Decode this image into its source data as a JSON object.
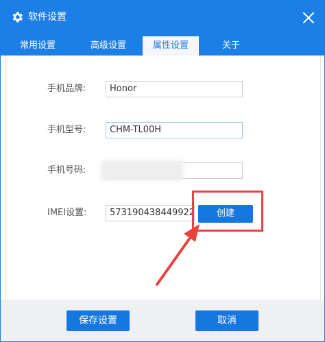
{
  "window": {
    "title": "软件设置"
  },
  "tabs": [
    {
      "label": "常用设置",
      "active": false
    },
    {
      "label": "高级设置",
      "active": false
    },
    {
      "label": "属性设置",
      "active": true
    },
    {
      "label": "关于",
      "active": false
    }
  ],
  "form": {
    "brand": {
      "label": "手机品牌:",
      "value": "Honor"
    },
    "model": {
      "label": "手机型号:",
      "value": "CHM-TL00H"
    },
    "number": {
      "label": "手机号码:",
      "value": ""
    },
    "imei": {
      "label": "IMEI设置:",
      "value": "573190438449922"
    }
  },
  "create_button": {
    "label": "创建"
  },
  "footer": {
    "save_label": "保存设置",
    "cancel_label": "取消"
  },
  "colors": {
    "accent": "#1c7fe6",
    "button": "#1777e0",
    "highlight": "#e8433f",
    "footer_bg": "#eef0f4"
  },
  "icons": {
    "title": "gear-icon",
    "close": "close-icon",
    "annotation": "red-arrow-icon"
  }
}
